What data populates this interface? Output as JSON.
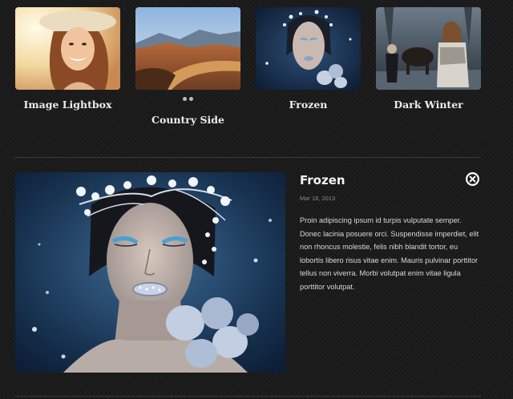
{
  "gallery": {
    "items": [
      {
        "caption": "Image Lightbox"
      },
      {
        "caption": "Country Side"
      },
      {
        "caption": "Frozen"
      },
      {
        "caption": "Dark Winter"
      }
    ],
    "pager_icon": "loading-dots-icon"
  },
  "detail": {
    "title": "Frozen",
    "date": "Mar 18, 2013",
    "body": "Proin adipiscing ipsum id turpis vulputate semper. Donec lacinia posuere orci. Suspendisse imperdiet, elit non rhoncus molestie, felis nibh blandit tortor, eu lobortis libero risus vitae enim. Mauris pulvinar porttitor tellus non viverra. Morbi volutpat enim vitae ligula porttitor volutpat.",
    "close_icon": "close-circle-icon"
  }
}
